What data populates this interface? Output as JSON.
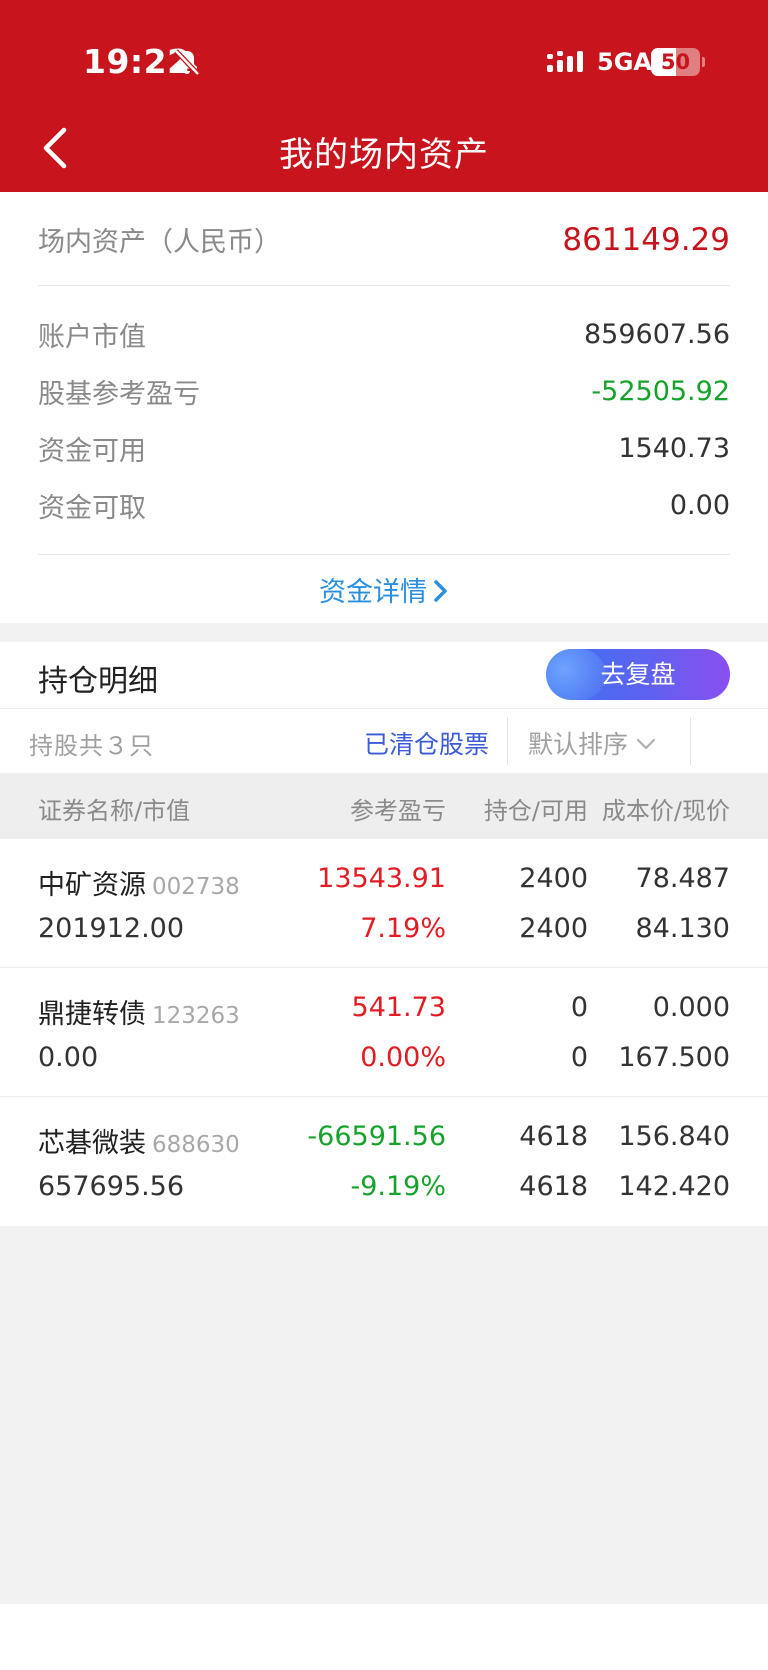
{
  "status_bar": {
    "time": "19:22",
    "network": "5GA",
    "battery": "50",
    "battery_level": 0.5
  },
  "header": {
    "title": "我的场内资产"
  },
  "summary": {
    "total_label": "场内资产（人民币）",
    "total_value": "861149.29",
    "rows": [
      {
        "label": "账户市值",
        "value": "859607.56",
        "color": "#333333"
      },
      {
        "label": "股基参考盈亏",
        "value": "-52505.92",
        "color": "#17a32b"
      },
      {
        "label": "资金可用",
        "value": "1540.73",
        "color": "#333333"
      },
      {
        "label": "资金可取",
        "value": "0.00",
        "color": "#333333"
      }
    ],
    "detail_link": "资金详情"
  },
  "holdings": {
    "section_title": "持仓明细",
    "review_button": "去复盘",
    "count_label": "持股共３只",
    "cleared_label": "已清仓股票",
    "sort_label": "默认排序",
    "columns": {
      "name": "证券名称/市值",
      "pnl": "参考盈亏",
      "position": "持仓/可用",
      "price": "成本价/现价"
    },
    "rows": [
      {
        "name": "中矿资源",
        "code": "002738",
        "market_value": "201912.00",
        "pnl": "13543.91",
        "pnl_pct": "7.19%",
        "pnl_color": "#e31b23",
        "position": "2400",
        "available": "2400",
        "cost": "78.487",
        "price": "84.130"
      },
      {
        "name": "鼎捷转债",
        "code": "123263",
        "market_value": "0.00",
        "pnl": "541.73",
        "pnl_pct": "0.00%",
        "pnl_color": "#e31b23",
        "position": "0",
        "available": "0",
        "cost": "0.000",
        "price": "167.500"
      },
      {
        "name": "芯碁微装",
        "code": "688630",
        "market_value": "657695.56",
        "pnl": "-66591.56",
        "pnl_pct": "-9.19%",
        "pnl_color": "#17a32b",
        "position": "4618",
        "available": "4618",
        "cost": "156.840",
        "price": "142.420"
      }
    ]
  },
  "colors": {
    "header_bg": "#c8151d",
    "up": "#e31b23",
    "down": "#17a32b",
    "link": "#2b8fe0"
  }
}
